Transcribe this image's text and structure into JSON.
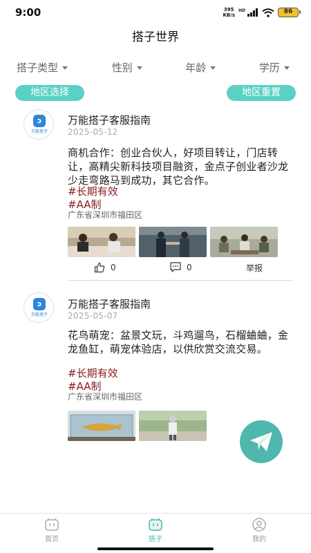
{
  "status_bar": {
    "time": "9:00",
    "net_speed_value": "395",
    "net_speed_unit": "KB/s",
    "hd": "HD",
    "battery": "86"
  },
  "header": {
    "title": "搭子世界"
  },
  "filters": [
    {
      "label": "搭子类型"
    },
    {
      "label": "性别"
    },
    {
      "label": "年龄"
    },
    {
      "label": "学历"
    }
  ],
  "region": {
    "select_label": "地区选择",
    "reset_label": "地区重置"
  },
  "posts": [
    {
      "avatar_text": "万能搭子",
      "name": "万能搭子客服指南",
      "date": "2025-05-12",
      "body": "商机合作：创业合伙人，好项目转让，门店转让，高精尖新科技项目融资，金点子创业者沙龙少走弯路马到成功，其它合作。",
      "tags": [
        "#长期有效",
        "#AA制"
      ],
      "location": "广东省深圳市福田区",
      "likes": "0",
      "comments": "0",
      "report_label": "举报"
    },
    {
      "avatar_text": "万能搭子",
      "name": "万能搭子客服指南",
      "date": "2025-05-07",
      "body": "花鸟萌宠：盆景文玩，斗鸡遛鸟，石榴蛐蛐，金龙鱼缸，萌宠体验店，以供欣赏交流交易。",
      "tags": [
        "#长期有效",
        "#AA制"
      ],
      "location": "广东省深圳市福田区"
    }
  ],
  "tabs": [
    {
      "label": "首页"
    },
    {
      "label": "搭子"
    },
    {
      "label": "我的"
    }
  ],
  "colors": {
    "accent": "#5ad1c4",
    "fab": "#4fb7ae",
    "tag": "#8b1a1a"
  }
}
